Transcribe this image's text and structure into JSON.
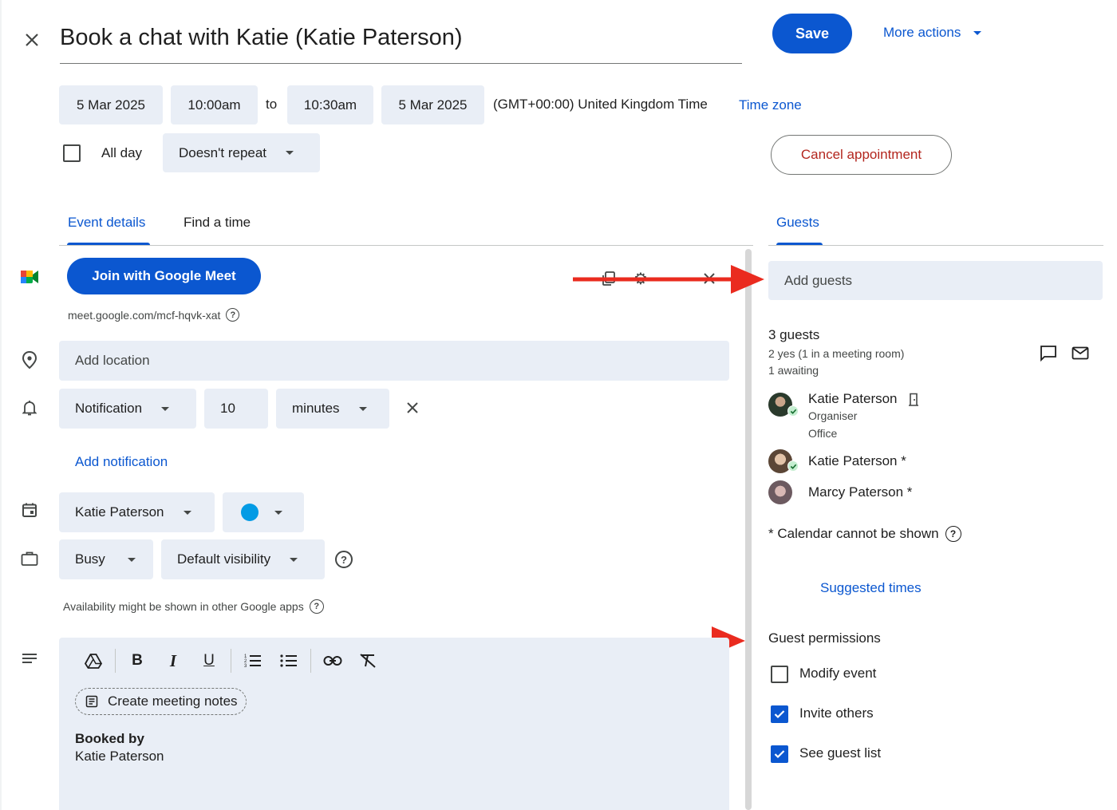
{
  "header": {
    "title": "Book a chat with Katie (Katie Paterson)",
    "save_label": "Save",
    "more_actions_label": "More actions"
  },
  "datetime": {
    "start_date": "5 Mar 2025",
    "start_time": "10:00am",
    "to_label": "to",
    "end_time": "10:30am",
    "end_date": "5 Mar 2025",
    "timezone_text": "(GMT+00:00) United Kingdom Time",
    "timezone_link": "Time zone",
    "all_day_label": "All day",
    "all_day_checked": false,
    "repeat_value": "Doesn't repeat",
    "cancel_label": "Cancel appointment"
  },
  "tabs": {
    "event_details": "Event details",
    "find_time": "Find a time",
    "guests": "Guests"
  },
  "meet": {
    "join_label": "Join with Google Meet",
    "link": "meet.google.com/mcf-hqvk-xat"
  },
  "location": {
    "placeholder": "Add location"
  },
  "notification": {
    "type": "Notification",
    "amount": "10",
    "unit": "minutes",
    "add_label": "Add notification"
  },
  "calendar": {
    "owner": "Katie Paterson",
    "color": "#039be5"
  },
  "availability": {
    "status": "Busy",
    "visibility": "Default visibility",
    "note": "Availability might be shown in other Google apps"
  },
  "description": {
    "create_notes_label": "Create meeting notes",
    "booked_by_label": "Booked by",
    "booked_by_name": "Katie Paterson"
  },
  "guests": {
    "add_placeholder": "Add guests",
    "count_label": "3 guests",
    "yes_summary": "2 yes (1 in a meeting room)",
    "awaiting_summary": "1 awaiting",
    "list": [
      {
        "name": "Katie Paterson",
        "role": "Organiser",
        "room": "Office"
      },
      {
        "name": "Katie Paterson *"
      },
      {
        "name": "Marcy Paterson *"
      }
    ],
    "calendar_note": "* Calendar cannot be shown",
    "suggested_times": "Suggested times"
  },
  "permissions": {
    "heading": "Guest permissions",
    "modify_label": "Modify event",
    "modify_checked": false,
    "invite_label": "Invite others",
    "invite_checked": true,
    "see_list_label": "See guest list",
    "see_list_checked": true
  },
  "colors": {
    "accent": "#0b57d0",
    "field_bg": "#e9eef6",
    "cancel_text": "#b3261e",
    "arrow": "#ea2b1f"
  }
}
